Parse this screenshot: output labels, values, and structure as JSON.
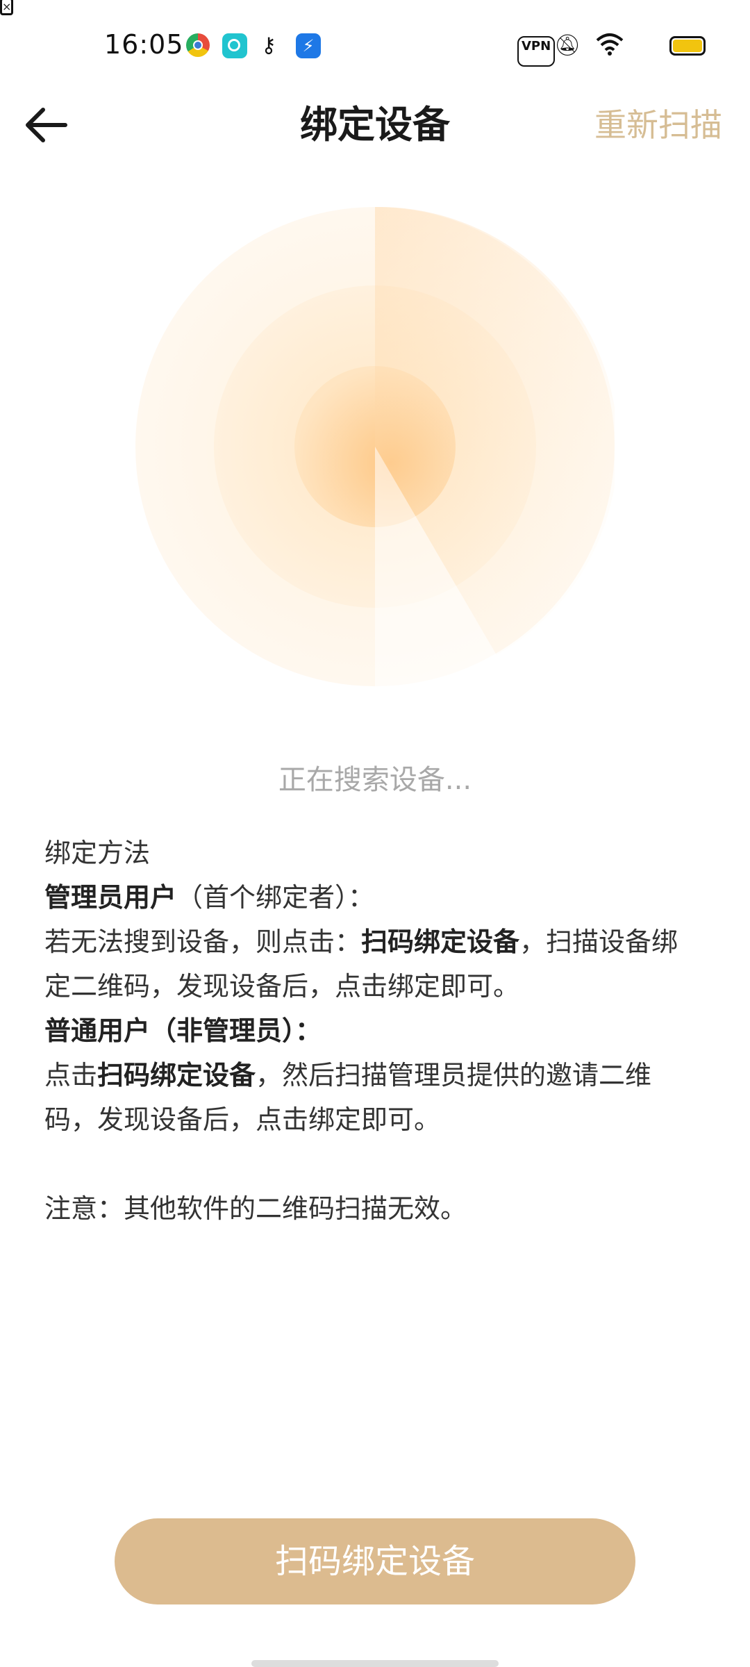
{
  "status_bar": {
    "time": "16:05",
    "left_icons": [
      "chrome-icon",
      "app-icon",
      "key-icon",
      "usb-icon"
    ],
    "right_icons": [
      "vpn-icon",
      "mute-icon",
      "wifi-icon",
      "sim-icon",
      "battery-icon"
    ],
    "vpn_label": "VPN"
  },
  "app_bar": {
    "title": "绑定设备",
    "action_label": "重新扫描"
  },
  "status_text": "正在搜索设备...",
  "instructions": {
    "heading": "绑定方法",
    "admin_title": "管理员用户",
    "admin_title_suffix": "（首个绑定者）：",
    "admin_text_before": "若无法搜到设备，则点击：",
    "admin_bold": "扫码绑定设备",
    "admin_text_after": "，扫描设备绑定二维码，发现设备后，点击绑定即可。",
    "user_title": "普通用户（非管理员）：",
    "user_text_before": "点击",
    "user_bold": "扫码绑定设备",
    "user_text_after": "，然后扫描管理员提供的邀请二维码，发现设备后，点击绑定即可。",
    "note": "注意：其他软件的二维码扫描无效。"
  },
  "primary_button_label": "扫码绑定设备",
  "colors": {
    "accent": "#d6bd94",
    "button": "#dcbb8f",
    "radar_core": "#fec886"
  }
}
